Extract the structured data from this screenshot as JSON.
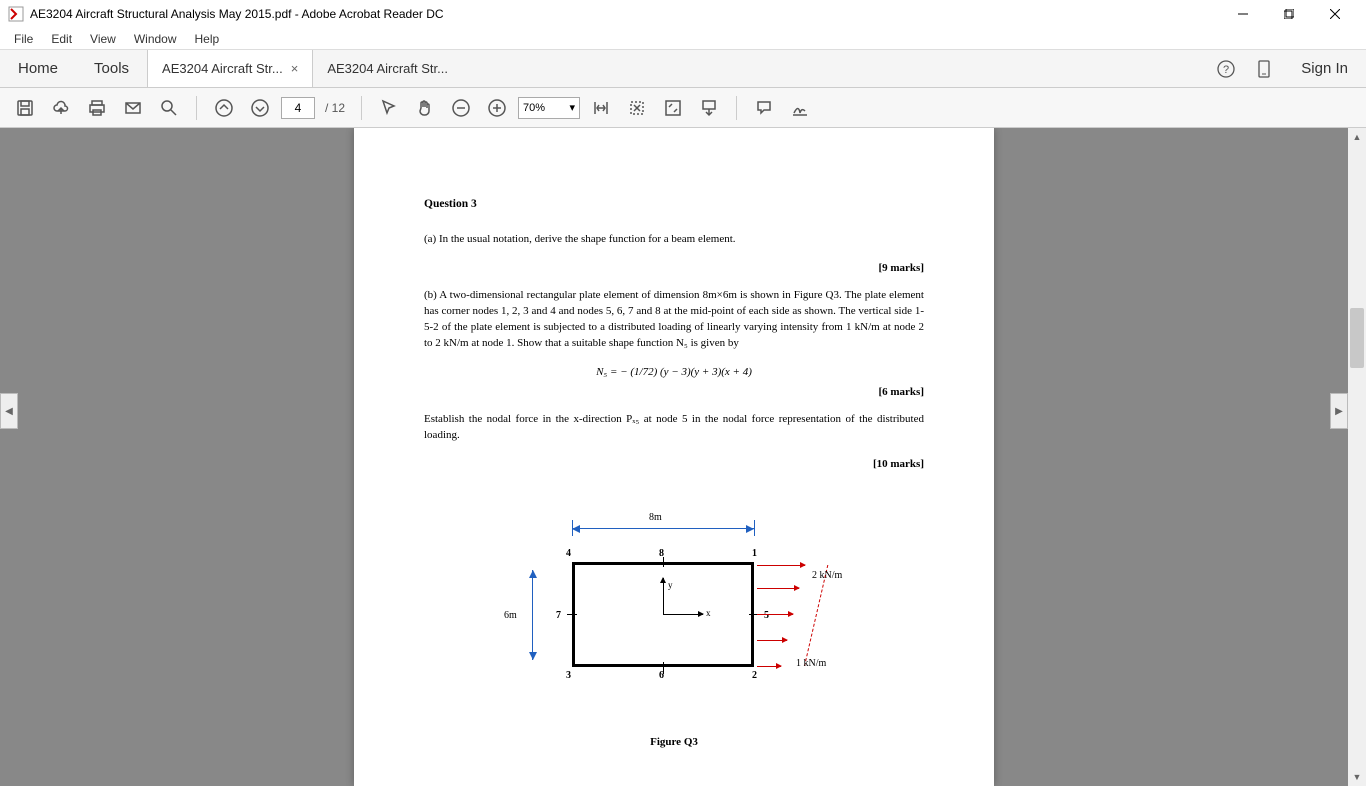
{
  "window": {
    "title": "AE3204 Aircraft Structural Analysis May 2015.pdf - Adobe Acrobat Reader DC"
  },
  "menu": {
    "file": "File",
    "edit": "Edit",
    "view": "View",
    "window": "Window",
    "help": "Help"
  },
  "tabs": {
    "home": "Home",
    "tools": "Tools",
    "doc1": "AE3204 Aircraft Str...",
    "doc2": "AE3204 Aircraft Str...",
    "signin": "Sign In"
  },
  "toolbar": {
    "page_current": "4",
    "page_total": "/ 12",
    "zoom": "70%"
  },
  "doc": {
    "q_title": "Question 3",
    "part_a": "(a)  In the usual notation, derive the shape function for a beam element.",
    "marks_a": "[9 marks]",
    "part_b": "(b)  A two-dimensional rectangular plate element of dimension 8m×6m is shown in Figure Q3. The plate element has corner nodes 1, 2, 3 and 4 and nodes 5, 6, 7 and 8 at the mid-point of each side as shown. The vertical side 1-5-2 of the plate element is subjected to a distributed loading of linearly varying intensity from 1 kN/m at node 2 to 2 kN/m at node 1. Show that a suitable shape function N₅ is given by",
    "eq": "N₅ =  − (1/72) (y − 3)(y + 3)(x + 4)",
    "marks_b": "[6 marks]",
    "part_c": "Establish the nodal force in the x-direction Pₓ₅  at node 5 in the nodal force representation of the distributed loading.",
    "marks_c": "[10 marks]",
    "dim_h": "8m",
    "dim_v": "6m",
    "axis_x": "x",
    "axis_y": "y",
    "n1": "1",
    "n2": "2",
    "n3": "3",
    "n4": "4",
    "n5": "5",
    "n6": "6",
    "n7": "7",
    "n8": "8",
    "load_top": "2 kN/m",
    "load_bot": "1 kN/m",
    "fig_caption": "Figure Q3"
  }
}
